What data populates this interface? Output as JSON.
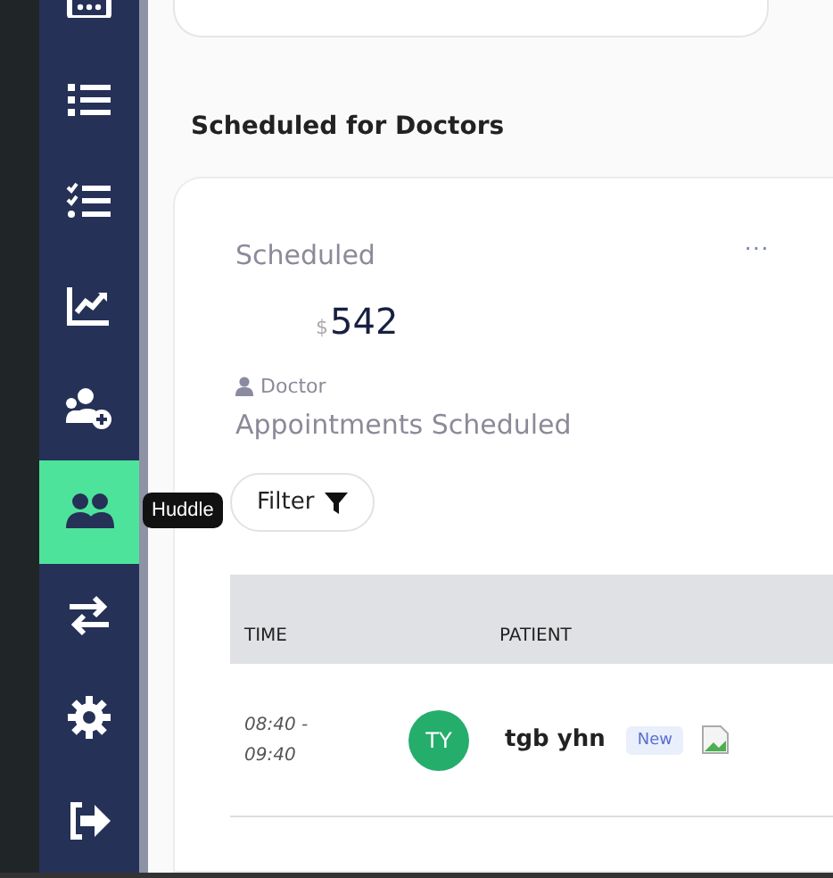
{
  "sidebar": {
    "items": [
      {
        "selected": false
      },
      {
        "selected": false
      },
      {
        "selected": false
      },
      {
        "selected": false
      },
      {
        "selected": false
      },
      {
        "selected": true
      },
      {
        "selected": false
      },
      {
        "selected": false
      },
      {
        "selected": false
      }
    ],
    "tooltip": "Huddle"
  },
  "section_title": "Scheduled for Doctors",
  "card": {
    "title": "Scheduled",
    "menu": "···",
    "currency": "$",
    "amount": "542",
    "role": "Doctor",
    "subtitle": "Appointments Scheduled",
    "filter": "Filter",
    "table": {
      "columns": [
        "TIME",
        "PATIENT"
      ],
      "rows": [
        {
          "time": [
            "08:40 -",
            "09:40"
          ],
          "initials": "TY",
          "patient": "tgb yhn",
          "badge": "New"
        }
      ]
    }
  }
}
